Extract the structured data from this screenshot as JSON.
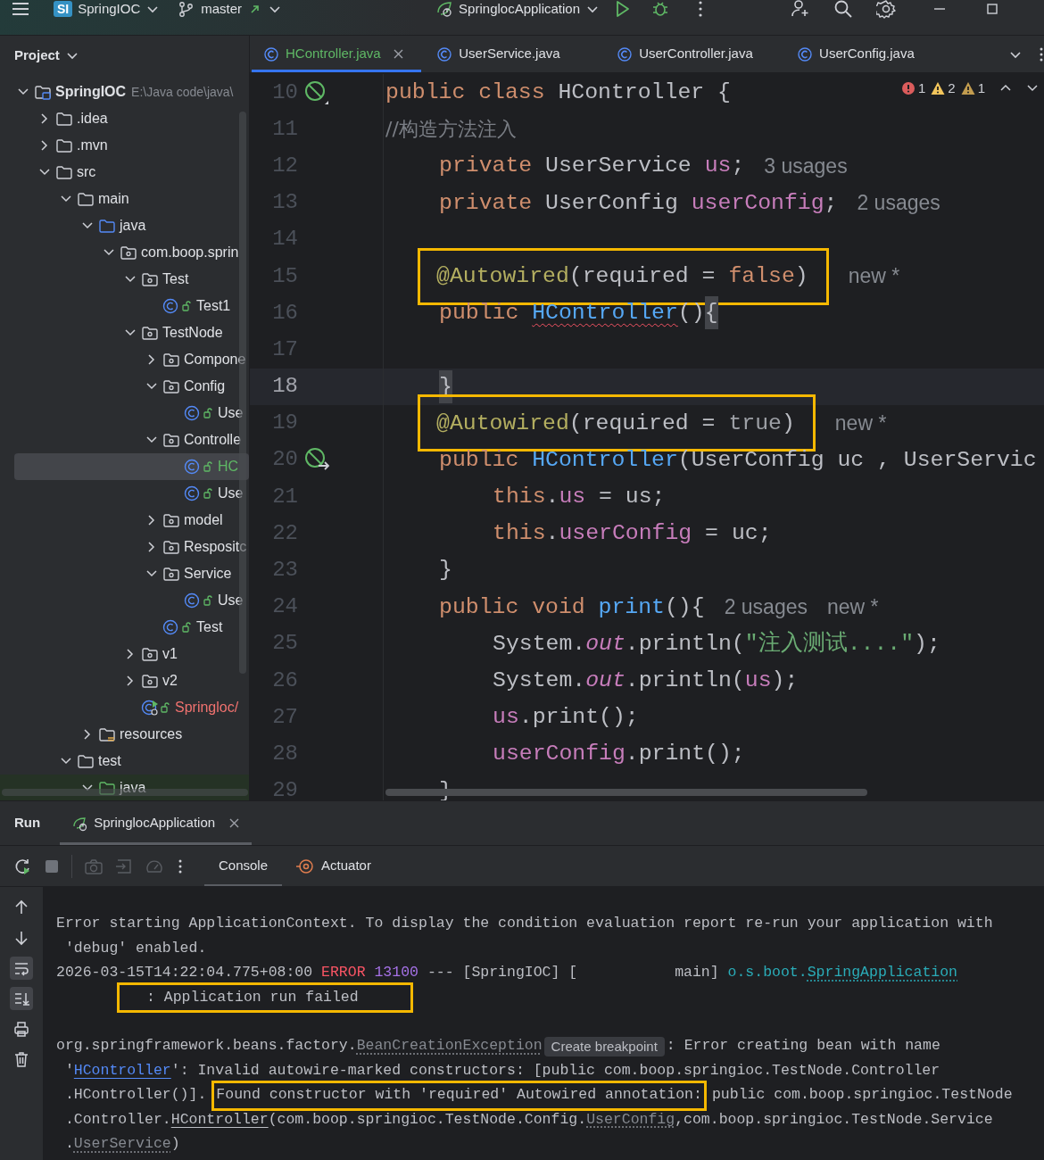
{
  "title_bar": {
    "badge": "SI",
    "project": "SpringIOC",
    "branch": "master",
    "run_config": "SpringlocApplication"
  },
  "project_panel": {
    "title": "Project",
    "tree": [
      {
        "label": "SpringIOC",
        "path": "E:\\Java code\\java\\",
        "kind": "project",
        "expanded": true,
        "selected": false,
        "children": [
          {
            "label": ".idea",
            "kind": "folder",
            "expanded": false,
            "selected": false
          },
          {
            "label": ".mvn",
            "kind": "folder",
            "expanded": false,
            "selected": false
          },
          {
            "label": "src",
            "kind": "folder",
            "expanded": true,
            "selected": false,
            "children": [
              {
                "label": "main",
                "kind": "folder",
                "expanded": true,
                "selected": false,
                "children": [
                  {
                    "label": "java",
                    "kind": "source",
                    "expanded": true,
                    "selected": false,
                    "children": [
                      {
                        "label": "com.boop.sprin",
                        "kind": "package",
                        "expanded": true,
                        "selected": false,
                        "children": [
                          {
                            "label": "Test",
                            "kind": "package",
                            "expanded": true,
                            "selected": false,
                            "children": [
                              {
                                "label": "Test1",
                                "kind": "class",
                                "selected": false
                              }
                            ]
                          },
                          {
                            "label": "TestNode",
                            "kind": "package",
                            "expanded": true,
                            "selected": false,
                            "children": [
                              {
                                "label": "Compone",
                                "kind": "package",
                                "expanded": false,
                                "selected": false
                              },
                              {
                                "label": "Config",
                                "kind": "package",
                                "expanded": true,
                                "selected": false,
                                "children": [
                                  {
                                    "label": "Use",
                                    "kind": "class",
                                    "selected": false
                                  }
                                ]
                              },
                              {
                                "label": "Controlle",
                                "kind": "package",
                                "expanded": true,
                                "selected": false,
                                "children": [
                                  {
                                    "label": "HC",
                                    "kind": "class",
                                    "selected": true,
                                    "color": "#5fb865"
                                  },
                                  {
                                    "label": "Use",
                                    "kind": "class",
                                    "selected": false
                                  }
                                ]
                              },
                              {
                                "label": "model",
                                "kind": "package",
                                "expanded": false,
                                "selected": false
                              },
                              {
                                "label": "Respositc",
                                "kind": "package",
                                "expanded": false,
                                "selected": false
                              },
                              {
                                "label": "Service",
                                "kind": "package",
                                "expanded": true,
                                "selected": false,
                                "children": [
                                  {
                                    "label": "Use",
                                    "kind": "class",
                                    "selected": false
                                  }
                                ]
                              },
                              {
                                "label": "Test",
                                "kind": "class",
                                "selected": false
                              }
                            ]
                          },
                          {
                            "label": "v1",
                            "kind": "package",
                            "expanded": false,
                            "selected": false
                          },
                          {
                            "label": "v2",
                            "kind": "package",
                            "expanded": false,
                            "selected": false
                          },
                          {
                            "label": "Springloc/",
                            "kind": "app",
                            "selected": false,
                            "color": "#f0726f"
                          }
                        ]
                      }
                    ]
                  },
                  {
                    "label": "resources",
                    "kind": "resources",
                    "expanded": false,
                    "selected": false
                  }
                ]
              },
              {
                "label": "test",
                "kind": "folder",
                "expanded": true,
                "selected": false,
                "children": [
                  {
                    "label": "java",
                    "kind": "test-source",
                    "expanded": true,
                    "selected": false
                  }
                ]
              }
            ]
          }
        ]
      }
    ]
  },
  "editor": {
    "tabs": [
      {
        "label": "HController.java",
        "selected": true,
        "modified": true
      },
      {
        "label": "UserService.java",
        "selected": false,
        "modified": false
      },
      {
        "label": "UserController.java",
        "selected": false,
        "modified": false
      },
      {
        "label": "UserConfig.java",
        "selected": false,
        "modified": false
      }
    ],
    "inspections": {
      "errors": "1",
      "warnings": "2",
      "weak_warnings": "1"
    },
    "lines": [
      {
        "number": "10",
        "kind": "top",
        "gutter": {
          "kind": "bean"
        },
        "current": false,
        "tokens": [
          {
            "t": "public class ",
            "kind": "keyword"
          },
          {
            "t": "HController {",
            "kind": "plain"
          }
        ]
      },
      {
        "number": "11",
        "kind": "top",
        "current": false,
        "tokens": [
          {
            "t": "//构造方法注入",
            "kind": "comment"
          }
        ]
      },
      {
        "number": "12",
        "kind": "member",
        "current": false,
        "tokens": [
          {
            "t": "private ",
            "kind": "keyword"
          },
          {
            "t": "UserService ",
            "kind": "plain"
          },
          {
            "t": "us",
            "kind": "field"
          },
          {
            "t": ";",
            "kind": "plain"
          },
          {
            "t": "3 usages",
            "kind": "hint"
          }
        ]
      },
      {
        "number": "13",
        "kind": "member",
        "current": false,
        "tokens": [
          {
            "t": "private ",
            "kind": "keyword"
          },
          {
            "t": "UserConfig ",
            "kind": "plain"
          },
          {
            "t": "userConfig",
            "kind": "field"
          },
          {
            "t": ";",
            "kind": "plain"
          },
          {
            "t": "2 usages",
            "kind": "hint"
          }
        ]
      },
      {
        "number": "14",
        "kind": "member",
        "current": false
      },
      {
        "number": "15",
        "kind": "member",
        "current": false,
        "tokens": [
          {
            "t": "@Autowired",
            "kind": "annotation",
            "boxed": true
          },
          {
            "t": "(required = ",
            "kind": "plain",
            "boxed": true
          },
          {
            "t": "false",
            "kind": "keyword",
            "boxed": true
          },
          {
            "t": ")",
            "kind": "plain",
            "boxed": true
          },
          {
            "t": "new *",
            "kind": "hint"
          }
        ]
      },
      {
        "number": "16",
        "kind": "member",
        "current": false,
        "tokens": [
          {
            "t": "public ",
            "kind": "keyword"
          },
          {
            "t": "HController",
            "kind": "method-error"
          },
          {
            "t": "()",
            "kind": "plain"
          },
          {
            "t": "{",
            "kind": "brace"
          }
        ]
      },
      {
        "number": "17",
        "kind": "member",
        "current": false
      },
      {
        "number": "18",
        "kind": "member",
        "current": true,
        "tokens": [
          {
            "t": "}",
            "kind": "brace"
          }
        ]
      },
      {
        "number": "19",
        "kind": "member",
        "current": false,
        "tokens": [
          {
            "t": "@Autowired",
            "kind": "annotation",
            "boxed": true
          },
          {
            "t": "(required = ",
            "kind": "plain",
            "boxed": true
          },
          {
            "t": "true",
            "kind": "dim",
            "boxed": true
          },
          {
            "t": ")",
            "kind": "plain",
            "boxed": true
          },
          {
            "t": "new *",
            "kind": "hint"
          }
        ]
      },
      {
        "number": "20",
        "kind": "member",
        "gutter": {
          "kind": "bean-arrow"
        },
        "current": false,
        "tokens": [
          {
            "t": "public ",
            "kind": "keyword"
          },
          {
            "t": "HController",
            "kind": "method"
          },
          {
            "t": "(UserConfig uc , UserServic",
            "kind": "plain"
          }
        ]
      },
      {
        "number": "21",
        "kind": "statement",
        "current": false,
        "tokens": [
          {
            "t": "this",
            "kind": "keyword"
          },
          {
            "t": ".",
            "kind": "plain"
          },
          {
            "t": "us",
            "kind": "field"
          },
          {
            "t": " = us;",
            "kind": "plain"
          }
        ]
      },
      {
        "number": "22",
        "kind": "statement",
        "current": false,
        "tokens": [
          {
            "t": "this",
            "kind": "keyword"
          },
          {
            "t": ".",
            "kind": "plain"
          },
          {
            "t": "userConfig",
            "kind": "field"
          },
          {
            "t": " = uc;",
            "kind": "plain"
          }
        ]
      },
      {
        "number": "23",
        "kind": "member",
        "current": false,
        "tokens": [
          {
            "t": "}",
            "kind": "plain"
          }
        ]
      },
      {
        "number": "24",
        "kind": "member",
        "current": false,
        "tokens": [
          {
            "t": "public void ",
            "kind": "keyword"
          },
          {
            "t": "print",
            "kind": "method"
          },
          {
            "t": "(){",
            "kind": "plain"
          },
          {
            "t": "2 usages",
            "kind": "hint"
          },
          {
            "t": "new *",
            "kind": "hint"
          }
        ]
      },
      {
        "number": "25",
        "kind": "statement",
        "current": false,
        "tokens": [
          {
            "t": "System.",
            "kind": "plain"
          },
          {
            "t": "out",
            "kind": "static"
          },
          {
            "t": ".println(",
            "kind": "plain"
          },
          {
            "t": "\"注入测试....\"",
            "kind": "string"
          },
          {
            "t": ");",
            "kind": "plain"
          }
        ]
      },
      {
        "number": "26",
        "kind": "statement",
        "current": false,
        "tokens": [
          {
            "t": "System.",
            "kind": "plain"
          },
          {
            "t": "out",
            "kind": "static"
          },
          {
            "t": ".println(",
            "kind": "plain"
          },
          {
            "t": "us",
            "kind": "field"
          },
          {
            "t": ");",
            "kind": "plain"
          }
        ]
      },
      {
        "number": "27",
        "kind": "statement",
        "current": false,
        "tokens": [
          {
            "t": "us",
            "kind": "field"
          },
          {
            "t": ".print();",
            "kind": "plain"
          }
        ]
      },
      {
        "number": "28",
        "kind": "statement",
        "current": false,
        "tokens": [
          {
            "t": "userConfig",
            "kind": "field"
          },
          {
            "t": ".print();",
            "kind": "plain"
          }
        ]
      },
      {
        "number": "29",
        "kind": "member",
        "current": false,
        "tokens": [
          {
            "t": "}",
            "kind": "plain"
          }
        ]
      }
    ]
  },
  "run_panel": {
    "title": "Run",
    "tabs": [
      {
        "label": "SpringlocApplication",
        "selected": true
      }
    ],
    "view_tabs": [
      {
        "label": "Console",
        "kind": "console",
        "selected": true
      },
      {
        "label": "Actuator",
        "kind": "actuator",
        "selected": false
      }
    ],
    "console_tools": [
      {
        "kind": "up",
        "on": false
      },
      {
        "kind": "down",
        "on": false
      },
      {
        "kind": "wrap",
        "on": true
      },
      {
        "kind": "scroll-end",
        "on": true
      },
      {
        "kind": "print",
        "on": false
      },
      {
        "kind": "trash",
        "on": false
      }
    ],
    "console": [
      {
        "lines": [
          {
            "kind": "start",
            "segments": [
              {
                "t": "Error starting ApplicationContext. To display the condition evaluation report re-run your application with",
                "kind": "text"
              }
            ]
          },
          {
            "kind": "start",
            "segments": [
              {
                "t": " 'debug' enabled.",
                "kind": "text"
              }
            ]
          },
          {
            "kind": "start",
            "segments": [
              {
                "t": "2026-03-15T14:22:04.775+08:00 ",
                "kind": "text"
              },
              {
                "t": "ERROR",
                "kind": "error"
              },
              {
                "t": "13100",
                "kind": "pid"
              },
              {
                "t": " --- [SpringIOC] [           main] ",
                "kind": "text"
              },
              {
                "t": "o.s.boot.",
                "kind": "logger"
              },
              {
                "t": "SpringApplication",
                "kind": "logger-link"
              }
            ]
          },
          {
            "kind": "continuation",
            "segments": [
              {
                "t": ": Application run failed",
                "kind": "text",
                "boxed": true
              }
            ]
          }
        ]
      },
      {
        "lines": [
          {
            "kind": "start",
            "segments": [
              {
                "t": "org.springframework.beans.factory.",
                "kind": "text"
              },
              {
                "t": "BeanCreationException",
                "kind": "class-link"
              },
              {
                "t": "Create breakpoint",
                "kind": "chip"
              },
              {
                "t": ": Error creating bean with name",
                "kind": "text"
              }
            ]
          },
          {
            "kind": "start",
            "segments": [
              {
                "t": " '",
                "kind": "text"
              },
              {
                "t": "HController",
                "kind": "link"
              },
              {
                "t": "': Invalid autowire-marked constructors: [public com.boop.springioc.TestNode.Controller",
                "kind": "text"
              }
            ]
          },
          {
            "kind": "start",
            "segments": [
              {
                "t": " .HController()].",
                "kind": "text"
              },
              {
                "t": "Found constructor with 'required' Autowired annotation:",
                "kind": "text",
                "boxed": true
              },
              {
                "t": "public com.boop.springioc.TestNode",
                "kind": "text"
              }
            ]
          },
          {
            "kind": "start",
            "segments": [
              {
                "t": " .Controller.",
                "kind": "text"
              },
              {
                "t": "HController",
                "kind": "code-link"
              },
              {
                "t": "(com.boop.springioc.TestNode.Config.",
                "kind": "text"
              },
              {
                "t": "UserConfig",
                "kind": "class-link"
              },
              {
                "t": ",com.boop.springioc.TestNode.Service",
                "kind": "text"
              }
            ]
          },
          {
            "kind": "start",
            "segments": [
              {
                "t": " .",
                "kind": "text"
              },
              {
                "t": "UserService",
                "kind": "class-link"
              },
              {
                "t": ")",
                "kind": "text"
              }
            ]
          }
        ]
      }
    ]
  }
}
